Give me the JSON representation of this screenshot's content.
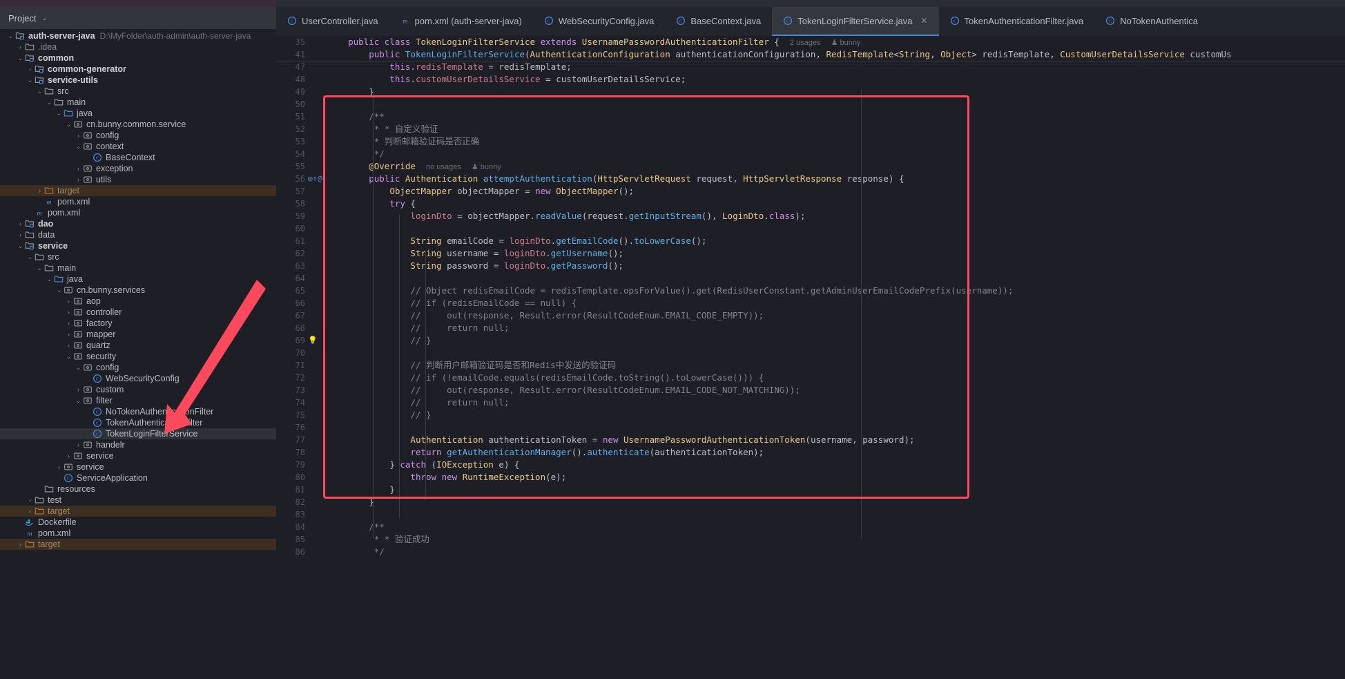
{
  "sidebar": {
    "panel_title": "Project",
    "panel_caret": "⌄",
    "tree": [
      {
        "depth": 0,
        "arrow": "⌄",
        "icon": "module-folder-icon",
        "label": "auth-server-java",
        "path": "D:\\MyFolder\\auth-admin\\auth-server-java",
        "style": "bold"
      },
      {
        "depth": 1,
        "arrow": "›",
        "icon": "folder-icon",
        "label": ".idea",
        "style": "muted"
      },
      {
        "depth": 1,
        "arrow": "⌄",
        "icon": "module-folder-icon",
        "label": "common",
        "style": "bold"
      },
      {
        "depth": 2,
        "arrow": "›",
        "icon": "module-folder-icon",
        "label": "common-generator",
        "style": "bold"
      },
      {
        "depth": 2,
        "arrow": "⌄",
        "icon": "module-folder-icon",
        "label": "service-utils",
        "style": "bold"
      },
      {
        "depth": 3,
        "arrow": "⌄",
        "icon": "folder-icon",
        "label": "src",
        "style": ""
      },
      {
        "depth": 4,
        "arrow": "⌄",
        "icon": "folder-icon",
        "label": "main",
        "style": ""
      },
      {
        "depth": 5,
        "arrow": "⌄",
        "icon": "source-folder-icon",
        "label": "java",
        "style": ""
      },
      {
        "depth": 6,
        "arrow": "⌄",
        "icon": "package-icon",
        "label": "cn.bunny.common.service",
        "style": ""
      },
      {
        "depth": 7,
        "arrow": "›",
        "icon": "package-icon",
        "label": "config",
        "style": ""
      },
      {
        "depth": 7,
        "arrow": "⌄",
        "icon": "package-icon",
        "label": "context",
        "style": ""
      },
      {
        "depth": 8,
        "arrow": "",
        "icon": "class-icon",
        "label": "BaseContext",
        "style": ""
      },
      {
        "depth": 7,
        "arrow": "›",
        "icon": "package-icon",
        "label": "exception",
        "style": ""
      },
      {
        "depth": 7,
        "arrow": "›",
        "icon": "package-icon",
        "label": "utils",
        "style": ""
      },
      {
        "depth": 3,
        "arrow": "›",
        "icon": "target-folder-icon",
        "label": "target",
        "style": "orange",
        "rowstyle": "target-row"
      },
      {
        "depth": 3,
        "arrow": "",
        "icon": "maven-icon",
        "label": "pom.xml",
        "style": ""
      },
      {
        "depth": 2,
        "arrow": "",
        "icon": "maven-icon",
        "label": "pom.xml",
        "style": ""
      },
      {
        "depth": 1,
        "arrow": "›",
        "icon": "module-folder-icon",
        "label": "dao",
        "style": "bold"
      },
      {
        "depth": 1,
        "arrow": "›",
        "icon": "folder-icon",
        "label": "data",
        "style": ""
      },
      {
        "depth": 1,
        "arrow": "⌄",
        "icon": "module-folder-icon",
        "label": "service",
        "style": "bold"
      },
      {
        "depth": 2,
        "arrow": "⌄",
        "icon": "folder-icon",
        "label": "src",
        "style": ""
      },
      {
        "depth": 3,
        "arrow": "⌄",
        "icon": "folder-icon",
        "label": "main",
        "style": ""
      },
      {
        "depth": 4,
        "arrow": "⌄",
        "icon": "source-folder-icon",
        "label": "java",
        "style": ""
      },
      {
        "depth": 5,
        "arrow": "⌄",
        "icon": "package-icon",
        "label": "cn.bunny.services",
        "style": ""
      },
      {
        "depth": 6,
        "arrow": "›",
        "icon": "package-icon",
        "label": "aop",
        "style": ""
      },
      {
        "depth": 6,
        "arrow": "›",
        "icon": "package-icon",
        "label": "controller",
        "style": ""
      },
      {
        "depth": 6,
        "arrow": "›",
        "icon": "package-icon",
        "label": "factory",
        "style": ""
      },
      {
        "depth": 6,
        "arrow": "›",
        "icon": "package-icon",
        "label": "mapper",
        "style": ""
      },
      {
        "depth": 6,
        "arrow": "›",
        "icon": "package-icon",
        "label": "quartz",
        "style": ""
      },
      {
        "depth": 6,
        "arrow": "⌄",
        "icon": "package-icon",
        "label": "security",
        "style": ""
      },
      {
        "depth": 7,
        "arrow": "⌄",
        "icon": "package-icon",
        "label": "config",
        "style": ""
      },
      {
        "depth": 8,
        "arrow": "",
        "icon": "class-icon",
        "label": "WebSecurityConfig",
        "style": ""
      },
      {
        "depth": 7,
        "arrow": "›",
        "icon": "package-icon",
        "label": "custom",
        "style": ""
      },
      {
        "depth": 7,
        "arrow": "⌄",
        "icon": "package-icon",
        "label": "filter",
        "style": ""
      },
      {
        "depth": 8,
        "arrow": "",
        "icon": "class-icon",
        "label": "NoTokenAuthenticationFilter",
        "style": ""
      },
      {
        "depth": 8,
        "arrow": "",
        "icon": "class-icon",
        "label": "TokenAuthenticationFilter",
        "style": ""
      },
      {
        "depth": 8,
        "arrow": "",
        "icon": "class-icon",
        "label": "TokenLoginFilterService",
        "style": "",
        "rowstyle": "sel"
      },
      {
        "depth": 7,
        "arrow": "›",
        "icon": "package-icon",
        "label": "handelr",
        "style": ""
      },
      {
        "depth": 6,
        "arrow": "›",
        "icon": "package-icon",
        "label": "service",
        "style": ""
      },
      {
        "depth": 5,
        "arrow": "›",
        "icon": "package-icon",
        "label": "service",
        "style": ""
      },
      {
        "depth": 5,
        "arrow": "",
        "icon": "class-icon",
        "label": "ServiceApplication",
        "style": ""
      },
      {
        "depth": 3,
        "arrow": "",
        "icon": "resources-folder-icon",
        "label": "resources",
        "style": ""
      },
      {
        "depth": 2,
        "arrow": "›",
        "icon": "folder-icon",
        "label": "test",
        "style": ""
      },
      {
        "depth": 2,
        "arrow": "›",
        "icon": "target-folder-icon",
        "label": "target",
        "style": "orange",
        "rowstyle": "target-row"
      },
      {
        "depth": 1,
        "arrow": "",
        "icon": "docker-icon",
        "label": "Dockerfile",
        "style": ""
      },
      {
        "depth": 1,
        "arrow": "",
        "icon": "maven-icon",
        "label": "pom.xml",
        "style": ""
      },
      {
        "depth": 1,
        "arrow": "›",
        "icon": "target-folder-icon",
        "label": "target",
        "style": "orange",
        "rowstyle": "target-row"
      }
    ]
  },
  "tabs": [
    {
      "label": "UserController.java",
      "icon": "class-icon",
      "active": false,
      "closable": false
    },
    {
      "label": "pom.xml (auth-server-java)",
      "icon": "maven-icon",
      "active": false,
      "closable": false
    },
    {
      "label": "WebSecurityConfig.java",
      "icon": "class-icon",
      "active": false,
      "closable": false
    },
    {
      "label": "BaseContext.java",
      "icon": "class-icon",
      "active": false,
      "closable": false
    },
    {
      "label": "TokenLoginFilterService.java",
      "icon": "class-icon",
      "active": true,
      "closable": true,
      "close_glyph": "✕"
    },
    {
      "label": "TokenAuthenticationFilter.java",
      "icon": "class-icon",
      "active": false,
      "closable": false
    },
    {
      "label": "NoTokenAuthentica",
      "icon": "class-icon",
      "active": false,
      "closable": false
    }
  ],
  "editor": {
    "sticky": [
      {
        "num": "35",
        "html": "    <span class='kw'>public class</span> <span class='typ'>TokenLoginFilterService</span> <span class='kw'>extends</span> <span class='typ'>UsernamePasswordAuthenticationFilter</span> <span class='pun'>{</span>  <span class='hint'>2 usages</span>  <span class='hint'>&#9823; bunny</span>"
      },
      {
        "num": "41",
        "html": "        <span class='kw'>public</span> <span class='fn'>TokenLoginFilterService</span><span class='pun'>(</span><span class='typ'>AuthenticationConfiguration</span> <span class='par'>authenticationConfiguration</span><span class='pun'>,</span> <span class='typ'>RedisTemplate</span><span class='pun'>&lt;</span><span class='typ'>String</span><span class='pun'>,</span> <span class='typ'>Object</span><span class='pun'>&gt;</span> <span class='par'>redisTemplate</span><span class='pun'>,</span> <span class='typ'>CustomUserDetailsService</span> <span class='par'>customUs</span>"
      }
    ],
    "lines": [
      {
        "num": "47",
        "html": "            <span class='kw'>this</span><span class='pun'>.</span><span class='fld'>redisTemplate</span> <span class='pun'>=</span> <span class='par'>redisTemplate</span><span class='pun'>;</span>"
      },
      {
        "num": "48",
        "html": "            <span class='kw'>this</span><span class='pun'>.</span><span class='fld'>customUserDetailsService</span> <span class='pun'>=</span> <span class='par'>customUserDetailsService</span><span class='pun'>;</span>"
      },
      {
        "num": "49",
        "html": "        <span class='pun'>}</span>"
      },
      {
        "num": "50",
        "html": ""
      },
      {
        "num": "51",
        "html": "        <span class='doc'>/**</span>"
      },
      {
        "num": "52",
        "html": "         <span class='doc'>* * 自定义验证</span>"
      },
      {
        "num": "53",
        "html": "         <span class='doc'>* 判断邮箱验证码是否正确</span>"
      },
      {
        "num": "54",
        "html": "         <span class='doc'>*/</span>"
      },
      {
        "num": "55",
        "html": "        <span class='ann'>@Override</span>  <span class='hint'>no usages</span>  <span class='hint'>&#9823; bunny</span>"
      },
      {
        "num": "56",
        "gutter": "override",
        "html": "        <span class='kw'>public</span> <span class='typ'>Authentication</span> <span class='fn'>attemptAuthentication</span><span class='pun'>(</span><span class='typ'>HttpServletRequest</span> <span class='par'>request</span><span class='pun'>,</span> <span class='typ'>HttpServletResponse</span> <span class='par'>response</span><span class='pun'>)</span> <span class='pun'>{</span>"
      },
      {
        "num": "57",
        "html": "            <span class='typ'>ObjectMapper</span> <span class='par'>objectMapper</span> <span class='pun'>=</span> <span class='kw'>new</span> <span class='typ'>ObjectMapper</span><span class='pun'>();</span>"
      },
      {
        "num": "58",
        "html": "            <span class='kw'>try</span> <span class='pun'>{</span>"
      },
      {
        "num": "59",
        "html": "                <span class='fld'>loginDto</span> <span class='pun'>=</span> <span class='par'>objectMapper</span><span class='pun'>.</span><span class='fn'>readValue</span><span class='pun'>(</span><span class='par'>request</span><span class='pun'>.</span><span class='fn'>getInputStream</span><span class='pun'>(),</span> <span class='typ'>LoginDto</span><span class='pun'>.</span><span class='kw'>class</span><span class='pun'>);</span>"
      },
      {
        "num": "60",
        "html": ""
      },
      {
        "num": "61",
        "html": "                <span class='typ'>String</span> <span class='par'>emailCode</span> <span class='pun'>=</span> <span class='fld'>loginDto</span><span class='pun'>.</span><span class='fn'>getEmailCode</span><span class='pun'>().</span><span class='fn'>toLowerCase</span><span class='pun'>();</span>"
      },
      {
        "num": "62",
        "html": "                <span class='typ'>String</span> <span class='par'>username</span> <span class='pun'>=</span> <span class='fld'>loginDto</span><span class='pun'>.</span><span class='fn'>getUsername</span><span class='pun'>();</span>"
      },
      {
        "num": "63",
        "html": "                <span class='typ'>String</span> <span class='par'>password</span> <span class='pun'>=</span> <span class='fld'>loginDto</span><span class='pun'>.</span><span class='fn'>getPassword</span><span class='pun'>();</span>"
      },
      {
        "num": "64",
        "html": ""
      },
      {
        "num": "65",
        "html": "                <span class='cmt'>// Object redisEmailCode = redisTemplate.opsForValue().get(RedisUserConstant.getAdminUserEmailCodePrefix(username));</span>"
      },
      {
        "num": "66",
        "html": "                <span class='cmt'>// if (redisEmailCode == null) {</span>"
      },
      {
        "num": "67",
        "html": "                <span class='cmt'>//     out(response, Result.error(ResultCodeEnum.EMAIL_CODE_EMPTY));</span>"
      },
      {
        "num": "68",
        "html": "                <span class='cmt'>//     return null;</span>"
      },
      {
        "num": "69",
        "gutter": "bulb",
        "caret": true,
        "html": "                <span class='cmt'>// }</span>"
      },
      {
        "num": "70",
        "html": ""
      },
      {
        "num": "71",
        "html": "                <span class='cmt'>// 判断用户邮箱验证码是否和Redis中发送的验证码</span>"
      },
      {
        "num": "72",
        "html": "                <span class='cmt'>// if (!emailCode.equals(redisEmailCode.toString().toLowerCase())) {</span>"
      },
      {
        "num": "73",
        "html": "                <span class='cmt'>//     out(response, Result.error(ResultCodeEnum.EMAIL_CODE_NOT_MATCHING));</span>"
      },
      {
        "num": "74",
        "html": "                <span class='cmt'>//     return null;</span>"
      },
      {
        "num": "75",
        "html": "                <span class='cmt'>// }</span>"
      },
      {
        "num": "76",
        "html": ""
      },
      {
        "num": "77",
        "html": "                <span class='typ'>Authentication</span> <span class='par'>authenticationToken</span> <span class='pun'>=</span> <span class='kw'>new</span> <span class='typ'>UsernamePasswordAuthenticationToken</span><span class='pun'>(</span><span class='par'>username</span><span class='pun'>,</span> <span class='par'>password</span><span class='pun'>);</span>"
      },
      {
        "num": "78",
        "html": "                <span class='kw'>return</span> <span class='fn'>getAuthenticationManager</span><span class='pun'>().</span><span class='fn'>authenticate</span><span class='pun'>(</span><span class='par'>authenticationToken</span><span class='pun'>);</span>"
      },
      {
        "num": "79",
        "html": "            <span class='pun'>}</span> <span class='kw'>catch</span> <span class='pun'>(</span><span class='typ'>IOException</span> <span class='par'>e</span><span class='pun'>)</span> <span class='pun'>{</span>"
      },
      {
        "num": "80",
        "html": "                <span class='kw'>throw new</span> <span class='typ'>RuntimeException</span><span class='pun'>(</span><span class='par'>e</span><span class='pun'>);</span>"
      },
      {
        "num": "81",
        "html": "            <span class='pun'>}</span>"
      },
      {
        "num": "82",
        "html": "        <span class='pun'>}</span>"
      },
      {
        "num": "83",
        "html": ""
      },
      {
        "num": "84",
        "html": "        <span class='doc'>/**</span>"
      },
      {
        "num": "85",
        "html": "         <span class='doc'>* * 验证成功</span>"
      },
      {
        "num": "86",
        "html": "         <span class='doc'>*/</span>"
      }
    ],
    "annotations": {
      "usages_2": "2 usages",
      "no_usages": "no usages",
      "author": "bunny"
    }
  },
  "colors": {
    "accent": "#4a88dd",
    "highlight_box": "#fc4a5c",
    "arrow": "#fc4a5c",
    "selection": "#2f3138",
    "target_row": "#3c2f22"
  }
}
